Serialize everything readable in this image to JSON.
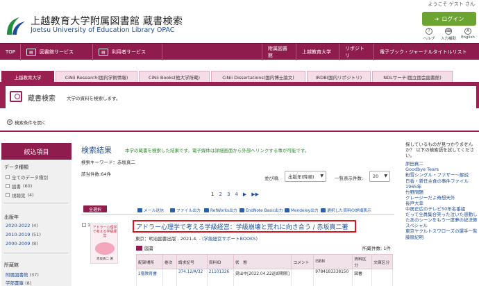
{
  "header": {
    "welcome": "ようこそ ゲスト さん",
    "title": "上越教育大学附属図書館 蔵書検索",
    "subtitle": "Joetsu University of Education Library OPAC",
    "login_label": "ログイン",
    "icons": [
      {
        "label": "ヘルプ",
        "glyph": "?"
      },
      {
        "label": "入力補助",
        "glyph": "⌨"
      },
      {
        "label": "English",
        "glyph": "A"
      }
    ]
  },
  "nav": {
    "top": "TOP",
    "library_services": "図書館サービス",
    "user_services": "利用者サービス",
    "right_links": [
      "附属図書館",
      "上越教育大学",
      "リポジトリ",
      "電子ブック・ジャーナルタイトルリスト"
    ]
  },
  "tabs": [
    "上越教育大学",
    "CiNii Research(国内学術情報)",
    "CiNii Books(他大学所蔵)",
    "CiNii Dissertations(国内博士論文)",
    "IRDB(国内リポジトリ)",
    "NDLサーチ(国立国会図書館)"
  ],
  "panel": {
    "title": "蔵書検索",
    "subtitle": "大学の資料を検索します。",
    "expand_label": "検索条件を開く"
  },
  "facets": {
    "header": "絞込項目",
    "data_type": {
      "label": "データ種類",
      "items": [
        {
          "label": "全てのデータ種別",
          "count": ""
        },
        {
          "label": "図書",
          "count": "(60)"
        },
        {
          "label": "視聴覚",
          "count": "(4)"
        }
      ]
    },
    "pub_year": {
      "label": "出版年",
      "items": [
        {
          "label": "2020-2022",
          "count": "(4)"
        },
        {
          "label": "2010-2019",
          "count": "(51)"
        },
        {
          "label": "2000-2009",
          "count": "(8)"
        }
      ]
    },
    "location": {
      "label": "所蔵館",
      "items": [
        {
          "label": "附属図書館",
          "count": "(37)"
        },
        {
          "label": "学部書庫",
          "count": "(8)"
        }
      ]
    }
  },
  "results": {
    "title": "検索結果",
    "message": "本学の蔵書を検索した結果です。電子媒体は詳細画面から外部へリンクする事が可能です。",
    "keyword": "検索キーワード：赤坂真二",
    "count": "該当件数:64件",
    "sort_label": "並び順:",
    "sort_value": "出版年(降順)",
    "per_page_label": "一覧表示件数:",
    "per_page_value": "20",
    "pages": [
      "1",
      "2",
      "3",
      "4",
      "▶",
      "▶▶"
    ],
    "select_all": "全選択",
    "toolbar": [
      "メール送信",
      "ファイル出力",
      "RefWorks出力",
      "EndNote Basic出力",
      "Mendeley出力",
      "選択した資料の詳細表示"
    ]
  },
  "item": {
    "number": "1.",
    "title": "アドラー心理学で考える学級経営：学級崩壊と荒れに向き合う / 赤坂真二著",
    "publisher": "東京：明治図書出版 , 2021.4. - ",
    "series": "(学級経営サポートBOOKS)",
    "type": "図書",
    "holdings_count": "所蔵件数: 1件",
    "cover_title": "アドラー心理学で考える学級経営",
    "cover_author": "赤坂真二 著",
    "holdings_headers": [
      "配架場所",
      "巻次",
      "請求記号",
      "資料ID",
      "状　態",
      "コメント",
      "ISBN",
      "資料区分",
      "文庫区分"
    ],
    "holdings_rows": [
      [
        "2階教育書",
        "",
        "374.12/A/32",
        "21101326",
        "貸出中[2022.04.22返却期限]",
        "",
        "9784183338150",
        "図書",
        ""
      ]
    ]
  },
  "right": {
    "header": "探しているものが見つかりませんか？ 以下の検索語を試してください。",
    "links": [
      "原田真二",
      "Goodbye Tears",
      "粉雪シングル・ファザー～解説",
      "日香・新任主食の事件ファイル",
      "1965年",
      "竹野問題",
      "クレージーだよ奇想天外",
      "長戸大幸",
      "中居正広のテレビ50年名番組",
      "だって全員集合笑った泣いた感動したあのシーンをもう一度夢の総決算スペシャル",
      "東京ヤクルトスワローズの選手一覧",
      "藤原紀明"
    ]
  }
}
